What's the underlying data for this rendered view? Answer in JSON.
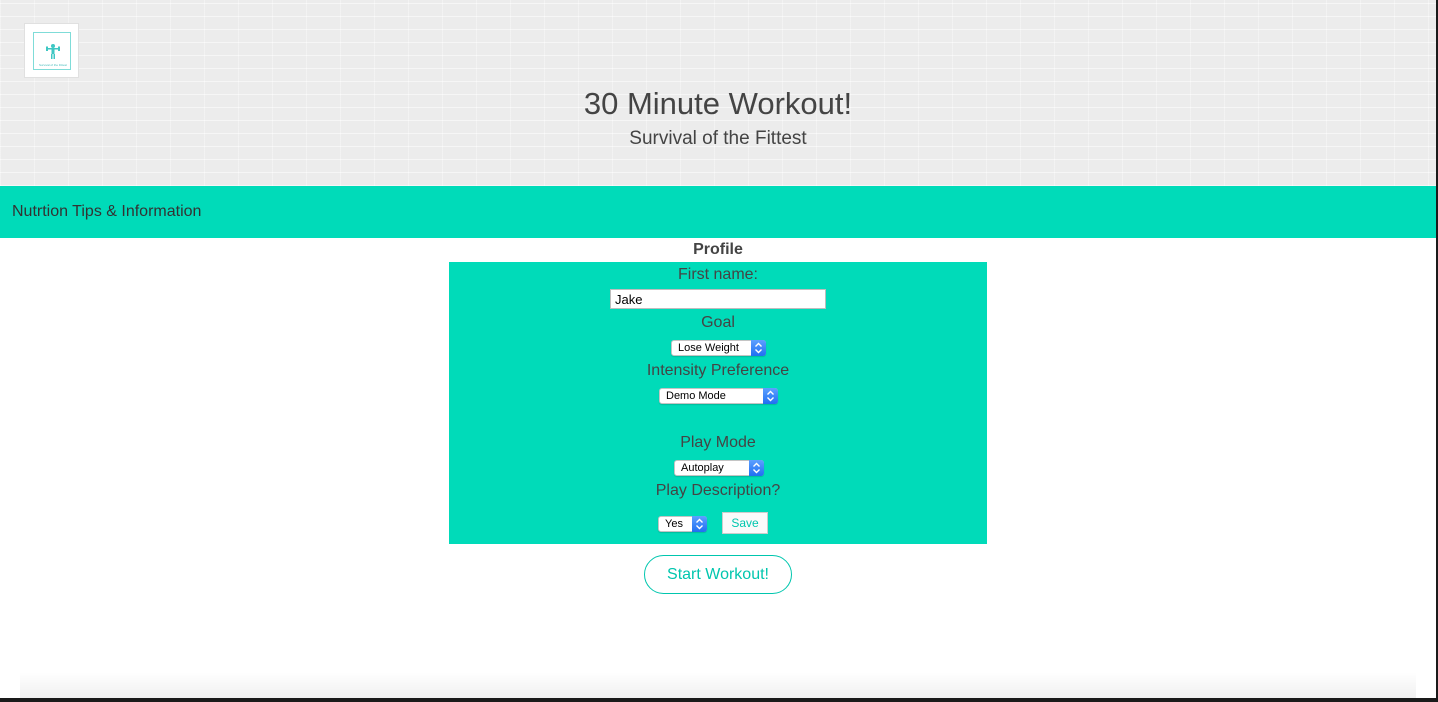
{
  "header": {
    "logo_icon": "dumbbell-figure-icon",
    "logo_text": "Survival of the Fittest",
    "title": "30 Minute Workout!",
    "subtitle": "Survival of the Fittest"
  },
  "nav": {
    "link_label": "Nutrtion Tips & Information"
  },
  "profile": {
    "heading": "Profile",
    "first_name_label": "First name:",
    "first_name_value": "Jake",
    "goal_label": "Goal",
    "goal_value": "Lose Weight",
    "intensity_label": "Intensity Preference",
    "intensity_value": "Demo Mode",
    "play_mode_label": "Play Mode",
    "play_mode_value": "Autoplay",
    "play_description_label": "Play Description?",
    "play_description_value": "Yes",
    "save_label": "Save"
  },
  "actions": {
    "start_label": "Start Workout!"
  },
  "colors": {
    "accent": "#00dbb9",
    "button_text": "#00c6ae",
    "select_arrow": "#1f6ff2"
  }
}
